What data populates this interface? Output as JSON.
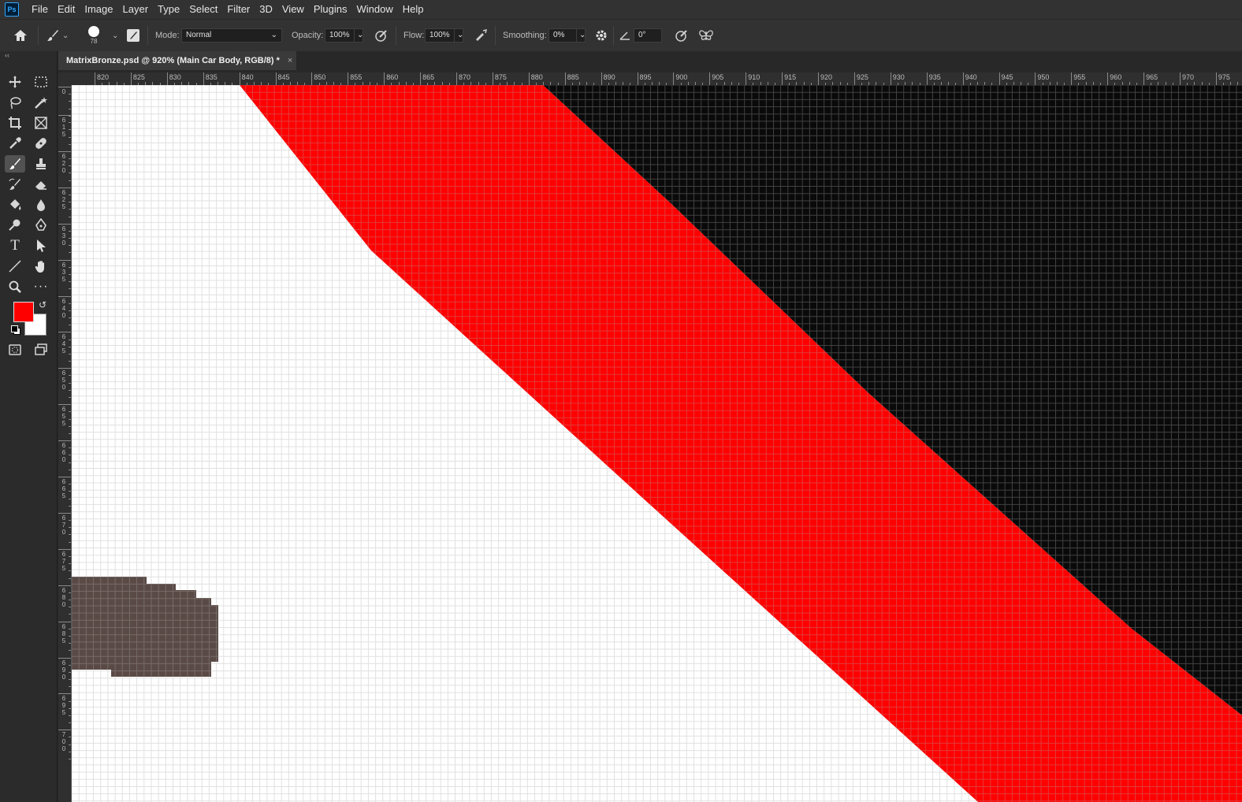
{
  "app": {
    "logo": "Ps"
  },
  "menu": [
    "File",
    "Edit",
    "Image",
    "Layer",
    "Type",
    "Select",
    "Filter",
    "3D",
    "View",
    "Plugins",
    "Window",
    "Help"
  ],
  "options": {
    "brush_size": "78",
    "mode_label": "Mode:",
    "mode_value": "Normal",
    "opacity_label": "Opacity:",
    "opacity_value": "100%",
    "flow_label": "Flow:",
    "flow_value": "100%",
    "smoothing_label": "Smoothing:",
    "smoothing_value": "0%",
    "angle_value": "0°"
  },
  "document": {
    "tab_title": "MatrixBronze.psd @ 920% (Main Car Body, RGB/8) *",
    "close_glyph": "×"
  },
  "ruler_top": [
    "820",
    "825",
    "830",
    "835",
    "840",
    "845",
    "850",
    "855",
    "860",
    "865",
    "870",
    "875",
    "880",
    "885",
    "890",
    "895",
    "900",
    "905",
    "910",
    "915",
    "920",
    "925",
    "930",
    "935",
    "940",
    "945",
    "950",
    "955",
    "960",
    "965",
    "970",
    "975"
  ],
  "ruler_left": [
    "0",
    "615",
    "620",
    "625",
    "630",
    "635",
    "640",
    "645",
    "650",
    "655",
    "660",
    "665",
    "670",
    "675",
    "680",
    "685",
    "690",
    "695",
    "700"
  ],
  "colors": {
    "foreground": "#ff0000",
    "background": "#ffffff",
    "stroke_red": "#ff0000",
    "dark_area": "#0a0a0a",
    "shape_brown": "#5a4a46"
  },
  "icons": {
    "home": "home-icon",
    "brush": "brush-icon",
    "settings": "gear-icon",
    "angle": "angle-icon",
    "symmetry": "butterfly-icon"
  }
}
